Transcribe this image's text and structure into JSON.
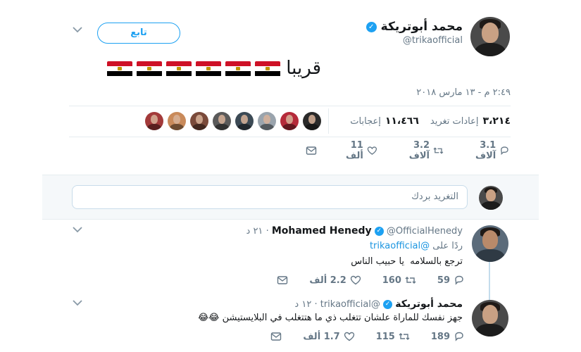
{
  "tweet": {
    "author_name": "محمد أبوتريكة",
    "author_handle": "@trikaofficial",
    "follow_label": "تابع",
    "text": "قريبا",
    "flag_count": 6,
    "timestamp": "٢:٤٩ م - ١٣ مارس ٢٠١٨",
    "stats": {
      "retweets_value": "٣،٢١٤",
      "retweets_label": "إعادات تغريد",
      "likes_value": "١١،٤٦٦",
      "likes_label": "إعجابات"
    },
    "likers_count": 8,
    "actions": {
      "replies": "3.1 آلاف",
      "retweets": "3.2 آلاف",
      "likes": "11 ألف"
    }
  },
  "reply_box": {
    "placeholder": "التغريد بردك"
  },
  "replies": [
    {
      "name": "Mohamed Henedy",
      "handle": "@OfficialHenedy",
      "time": "٢١ د",
      "replying_prefix": "ردًا على",
      "replying_to": "@trikaofficial",
      "text": "ترجع بالسلامه  يا حبيب الناس",
      "replies": "59",
      "retweets": "160",
      "likes": "2.2 ألف"
    },
    {
      "name": "محمد أبوتريكة",
      "handle": "@trikaofficial",
      "time": "١٢ د",
      "text": "جهز نفسك للماراة علشان تتغلب ذي ما هتتغلب في البلايستيشن 😂😂",
      "replies": "189",
      "retweets": "115",
      "likes": "1.7 ألف"
    }
  ],
  "colors": {
    "accent": "#1da1f2",
    "link": "#1b95e0",
    "muted": "#657786",
    "divider": "#e6ecf0",
    "reply_box_bg": "#f5f8fa"
  }
}
